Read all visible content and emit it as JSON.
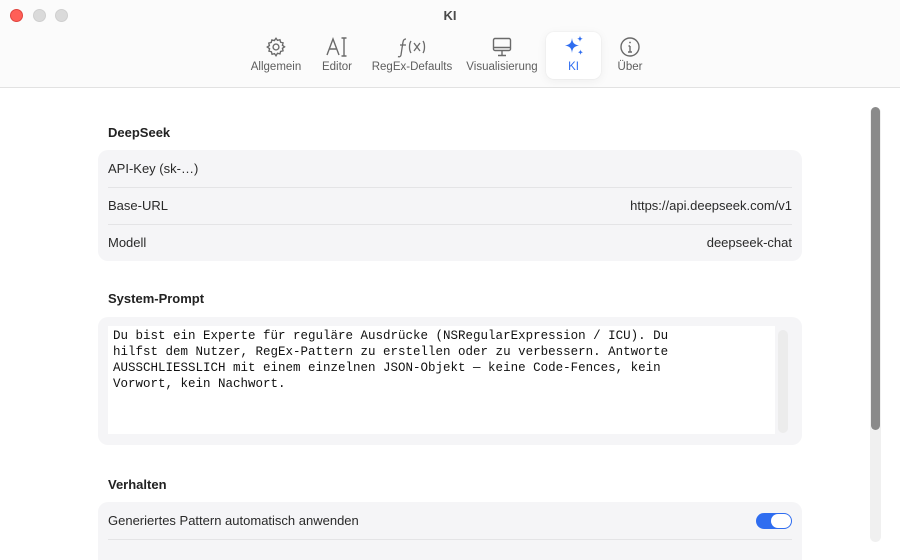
{
  "window": {
    "title": "KI"
  },
  "toolbar": {
    "tabs": [
      {
        "label": "Allgemein",
        "icon": "gear-icon"
      },
      {
        "label": "Editor",
        "icon": "text-cursor-icon"
      },
      {
        "label": "RegEx-Defaults",
        "icon": "function-icon"
      },
      {
        "label": "Visualisierung",
        "icon": "display-icon"
      },
      {
        "label": "KI",
        "icon": "sparkles-icon"
      },
      {
        "label": "Über",
        "icon": "info-icon"
      }
    ],
    "active_tab": "KI",
    "accent_color": "#2f6df0"
  },
  "deepseek": {
    "title": "DeepSeek",
    "api_key_label": "API-Key (sk-…)",
    "api_key_value": "",
    "base_url_label": "Base-URL",
    "base_url_value": "https://api.deepseek.com/v1",
    "model_label": "Modell",
    "model_value": "deepseek-chat"
  },
  "system_prompt": {
    "title": "System-Prompt",
    "text": "Du bist ein Experte für reguläre Ausdrücke (NSRegularExpression / ICU). Du\nhilfst dem Nutzer, RegEx-Pattern zu erstellen oder zu verbessern. Antworte\nAUSSCHLIESSLICH mit einem einzelnen JSON-Objekt — keine Code-Fences, kein\nVorwort, kein Nachwort."
  },
  "behavior": {
    "title": "Verhalten",
    "auto_apply_label": "Generiertes Pattern automatisch anwenden",
    "auto_apply_on": true
  }
}
